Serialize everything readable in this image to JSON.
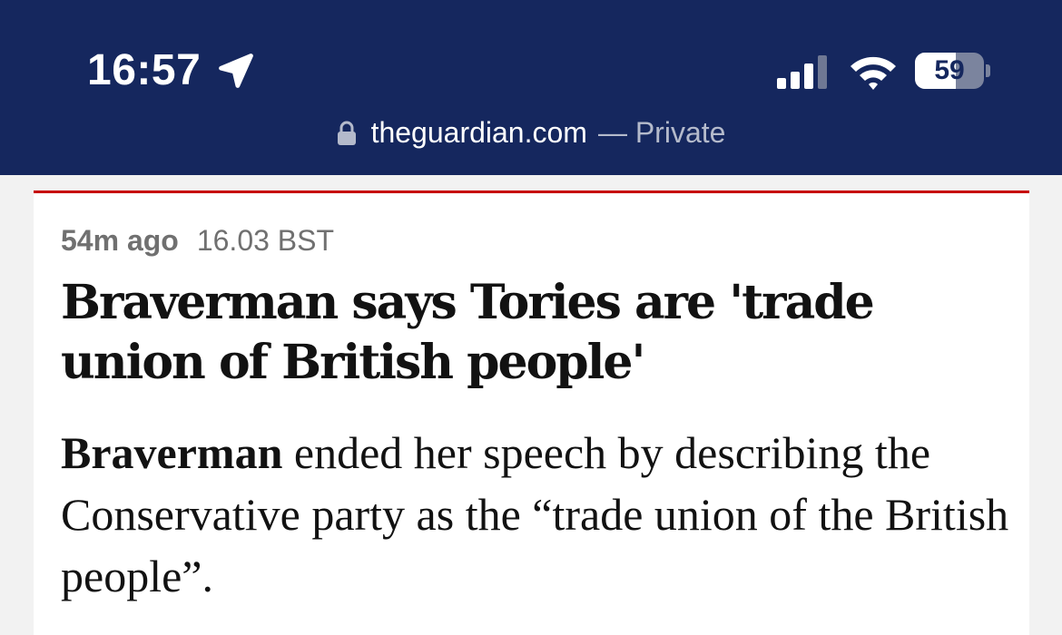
{
  "status_bar": {
    "time": "16:57",
    "battery_level": "59",
    "battery_fraction": 0.59
  },
  "browser": {
    "domain": "theguardian.com",
    "private_label": "— Private"
  },
  "post": {
    "relative_time": "54m ago",
    "timestamp": "16.03 BST",
    "headline": "Braverman says Tories are 'trade union of British people'",
    "body_lead": "Braverman",
    "body_rest": " ended her speech by describing the Conservative party as the “trade union of the British people”."
  },
  "colors": {
    "header_bg": "#15275e",
    "accent_red": "#c70000",
    "page_bg": "#f2f2f2",
    "text": "#121212",
    "meta_text": "#707070"
  },
  "icons": {
    "location": "location-arrow-icon",
    "signal": "cellular-signal-icon",
    "wifi": "wifi-icon",
    "battery": "battery-icon",
    "lock": "lock-icon"
  }
}
